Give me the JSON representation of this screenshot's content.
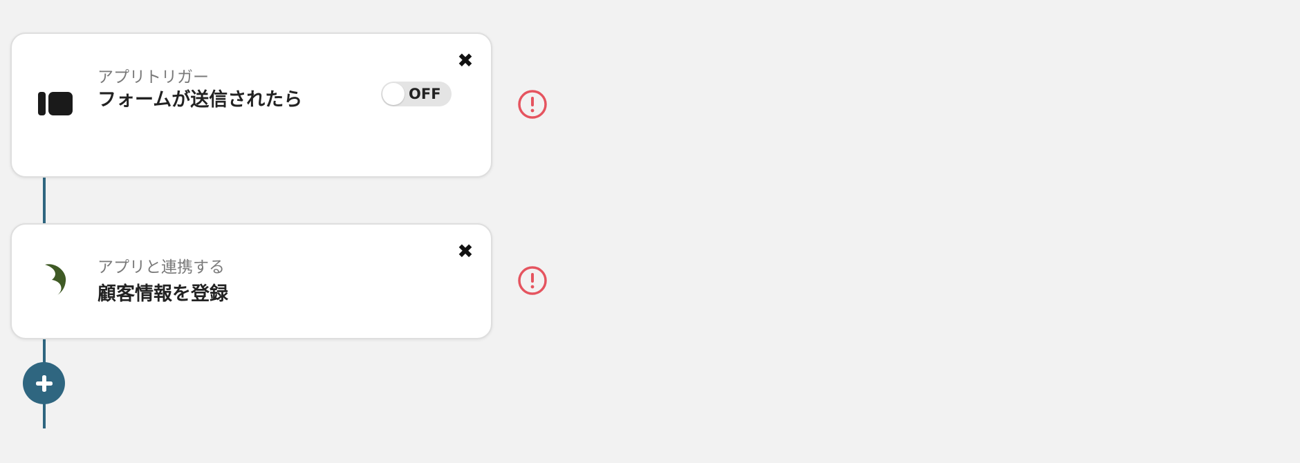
{
  "flow": {
    "steps": [
      {
        "kind_label": "アプリトリガー",
        "title": "フォームが送信されたら",
        "icon": "form-app-icon",
        "toggle_label": "OFF",
        "toggle_on": false,
        "status_icon": "warning-icon",
        "close_icon": "close-icon"
      },
      {
        "kind_label": "アプリと連携する",
        "title": "顧客情報を登録",
        "icon": "crescent-app-icon",
        "status_icon": "warning-icon",
        "close_icon": "close-icon"
      }
    ],
    "add_step_icon": "plus-icon"
  },
  "colors": {
    "background": "#f2f2f2",
    "connector": "#2f6680",
    "add_button": "#2f6680",
    "warning": "#e5545f",
    "crescent_icon": "#3f5a25",
    "form_icon": "#1a1a1a"
  }
}
